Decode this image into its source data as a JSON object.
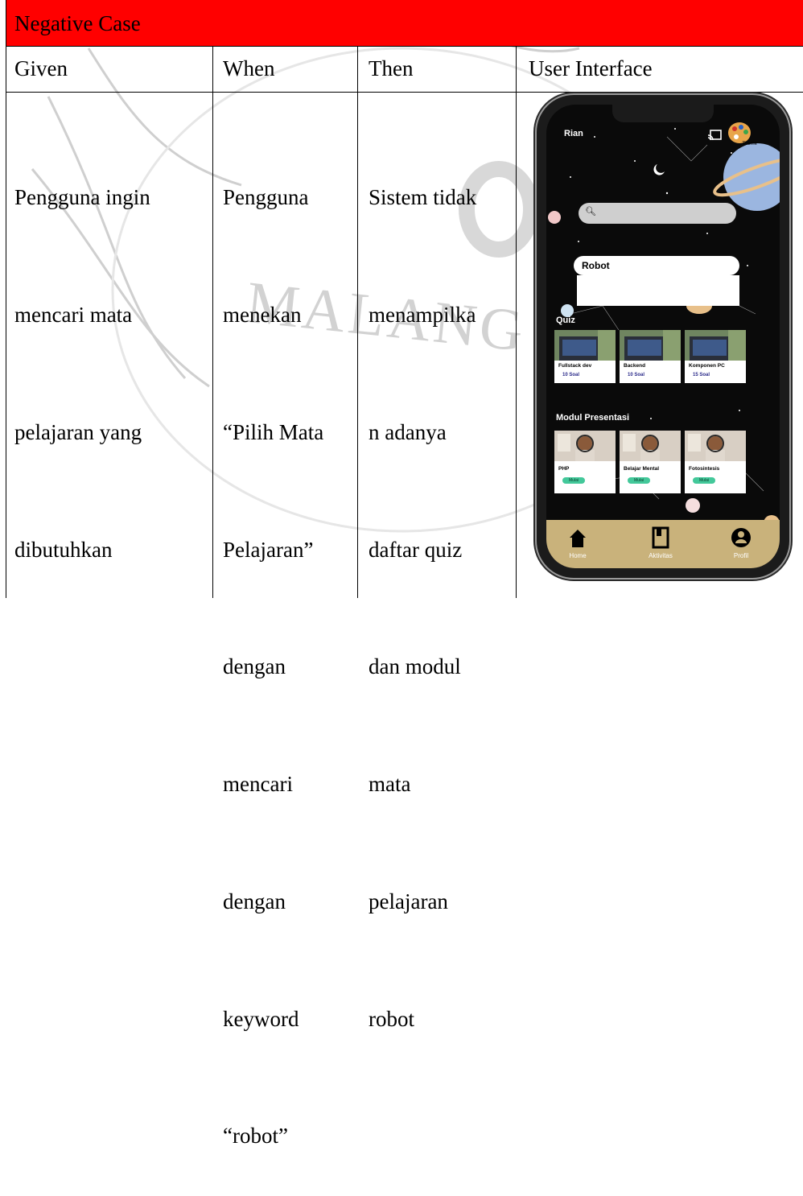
{
  "table": {
    "section_label": "Negative Case",
    "columns": [
      "Given",
      "When",
      "Then",
      "User Interface"
    ],
    "given_lines": [
      "Pengguna ingin",
      "mencari mata",
      "pelajaran yang",
      "dibutuhkan"
    ],
    "when_lines": [
      "Pengguna",
      "menekan",
      "“Pilih Mata",
      "Pelajaran”",
      "dengan",
      "mencari",
      "dengan",
      "keyword",
      "“robot”"
    ],
    "then_lines": [
      "Sistem tidak",
      "menampilka",
      "n adanya",
      "daftar quiz",
      "dan modul",
      "mata",
      "pelajaran",
      "robot"
    ]
  },
  "watermark": {
    "text": "MALANG"
  },
  "phone": {
    "user_name": "Rian",
    "theme_label": "Theme",
    "search_value": "",
    "query_value": "Robot",
    "quiz_label": "Quiz",
    "quiz_cards": [
      {
        "title": "Fullstack dev",
        "count": "10 Soal"
      },
      {
        "title": "Backend",
        "count": "10 Soal"
      },
      {
        "title": "Komponen PC",
        "count": "15 Soal"
      }
    ],
    "modul_label": "Modul Presentasi",
    "modul_cards": [
      {
        "title": "PHP",
        "action": "Mulai"
      },
      {
        "title": "Belajar Mental",
        "action": "Mulai"
      },
      {
        "title": "Fotosintesis",
        "action": "Mulai"
      }
    ],
    "nav": [
      {
        "label": "Home",
        "icon": "home-icon"
      },
      {
        "label": "Aktivitas",
        "icon": "book-icon"
      },
      {
        "label": "Profil",
        "icon": "profile-icon"
      }
    ]
  },
  "colors": {
    "header_red": "#ff0000",
    "nav_gold": "#c9b27b",
    "pill_green": "#43c89a",
    "planet_blue": "#9bb6e0"
  }
}
